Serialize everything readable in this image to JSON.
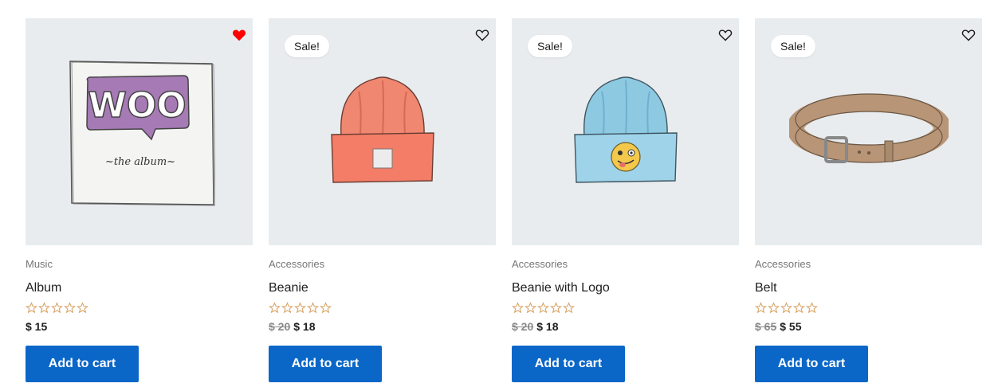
{
  "currency": "$",
  "colors": {
    "accent": "#0a67c8",
    "star": "#d9a66a",
    "heart_active": "#ff0000"
  },
  "products": [
    {
      "category": "Music",
      "name": "Album",
      "rating": 0,
      "price_old": "",
      "price": "$ 15",
      "sale_badge": "",
      "wishlisted": true,
      "add_to_cart": "Add to cart",
      "image": "woo-album-icon",
      "image_text": {
        "big": "WOO",
        "small": "~the album~"
      }
    },
    {
      "category": "Accessories",
      "name": "Beanie",
      "rating": 0,
      "price_old": "$ 20",
      "price": "$ 18",
      "sale_badge": "Sale!",
      "wishlisted": false,
      "add_to_cart": "Add to cart",
      "image": "orange-beanie-icon"
    },
    {
      "category": "Accessories",
      "name": "Beanie with Logo",
      "rating": 0,
      "price_old": "$ 20",
      "price": "$ 18",
      "sale_badge": "Sale!",
      "wishlisted": false,
      "add_to_cart": "Add to cart",
      "image": "blue-beanie-logo-icon"
    },
    {
      "category": "Accessories",
      "name": "Belt",
      "rating": 0,
      "price_old": "$ 65",
      "price": "$ 55",
      "sale_badge": "Sale!",
      "wishlisted": false,
      "add_to_cart": "Add to cart",
      "image": "belt-icon"
    }
  ]
}
